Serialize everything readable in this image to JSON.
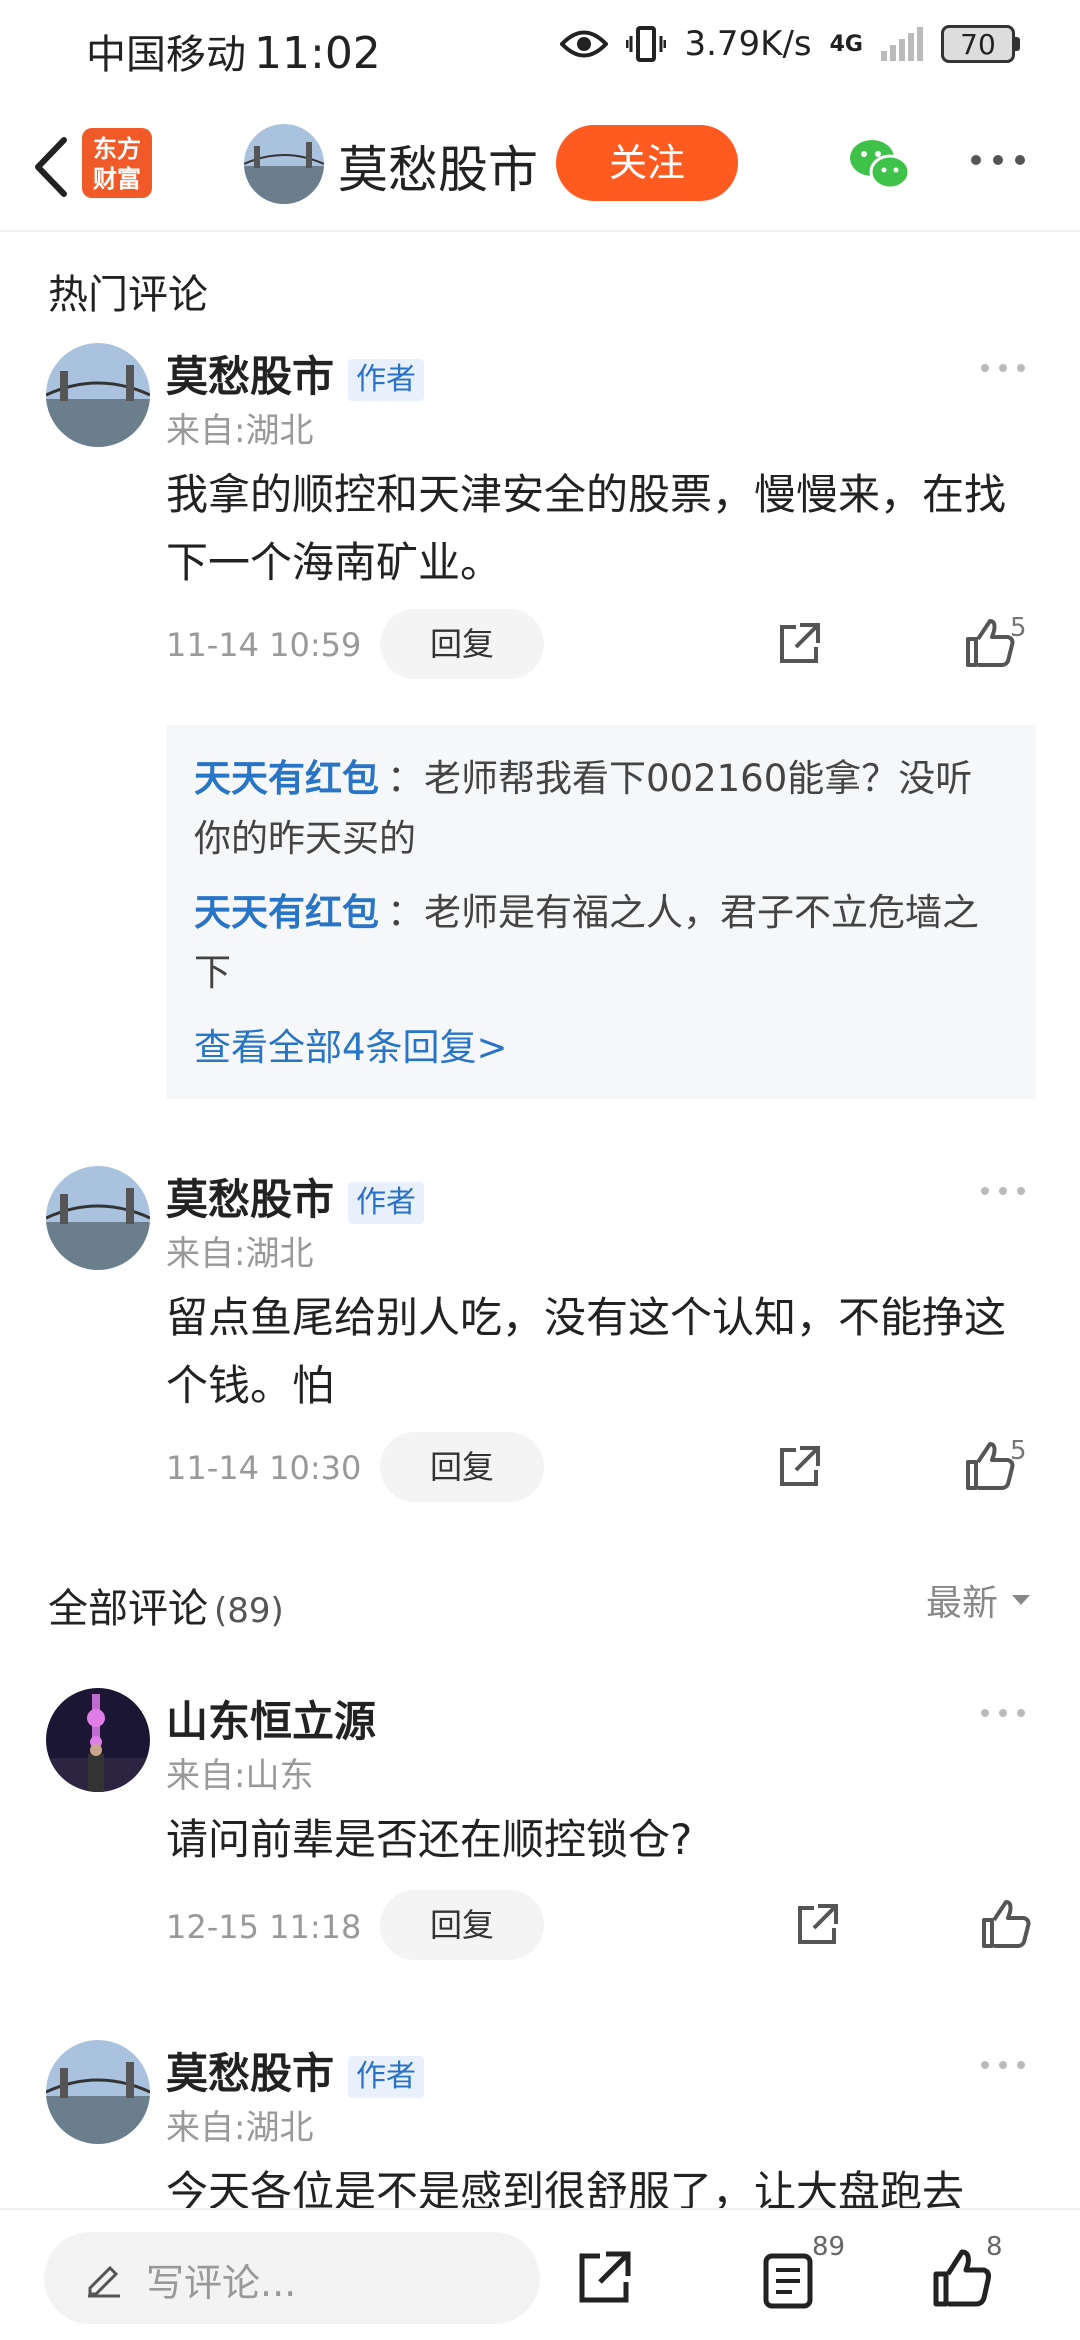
{
  "status": {
    "carrier": "中国移动",
    "time": "11:02",
    "speed": "3.79K/s",
    "network": "4G",
    "battery": "70"
  },
  "nav": {
    "logo_line1": "东方",
    "logo_line2": "财富",
    "title": "莫愁股市",
    "follow_label": "关注"
  },
  "hot_section": {
    "title": "热门评论"
  },
  "all_section": {
    "title": "全部评论",
    "count": "(89)",
    "sort_label": "最新"
  },
  "comments": [
    {
      "name": "莫愁股市",
      "badge": "作者",
      "from": "来自:湖北",
      "text": "我拿的顺控和天津安全的股票，慢慢来，在找下一个海南矿业。",
      "time": "11-14 10:59",
      "reply_label": "回复",
      "likes": "5",
      "replies": [
        {
          "user": "天天有红包",
          "text": "：老师帮我看下002160能拿？没听你的昨天买的"
        },
        {
          "user": "天天有红包",
          "text": "：老师是有福之人，君子不立危墙之下"
        }
      ],
      "view_all": "查看全部4条回复>"
    },
    {
      "name": "莫愁股市",
      "badge": "作者",
      "from": "来自:湖北",
      "text": "留点鱼尾给别人吃，没有这个认知，不能挣这个钱。怕",
      "time": "11-14 10:30",
      "reply_label": "回复",
      "likes": "5"
    },
    {
      "name": "山东恒立源",
      "from": "来自:山东",
      "text": "请问前辈是否还在顺控锁仓?",
      "time": "12-15 11:18",
      "reply_label": "回复"
    },
    {
      "name": "莫愁股市",
      "badge": "作者",
      "from": "来自:湖北",
      "text": "今天各位是不是感到很舒服了，让大盘跑去"
    }
  ],
  "bottom": {
    "write_placeholder": "写评论...",
    "comment_count": "89",
    "like_count": "8"
  }
}
